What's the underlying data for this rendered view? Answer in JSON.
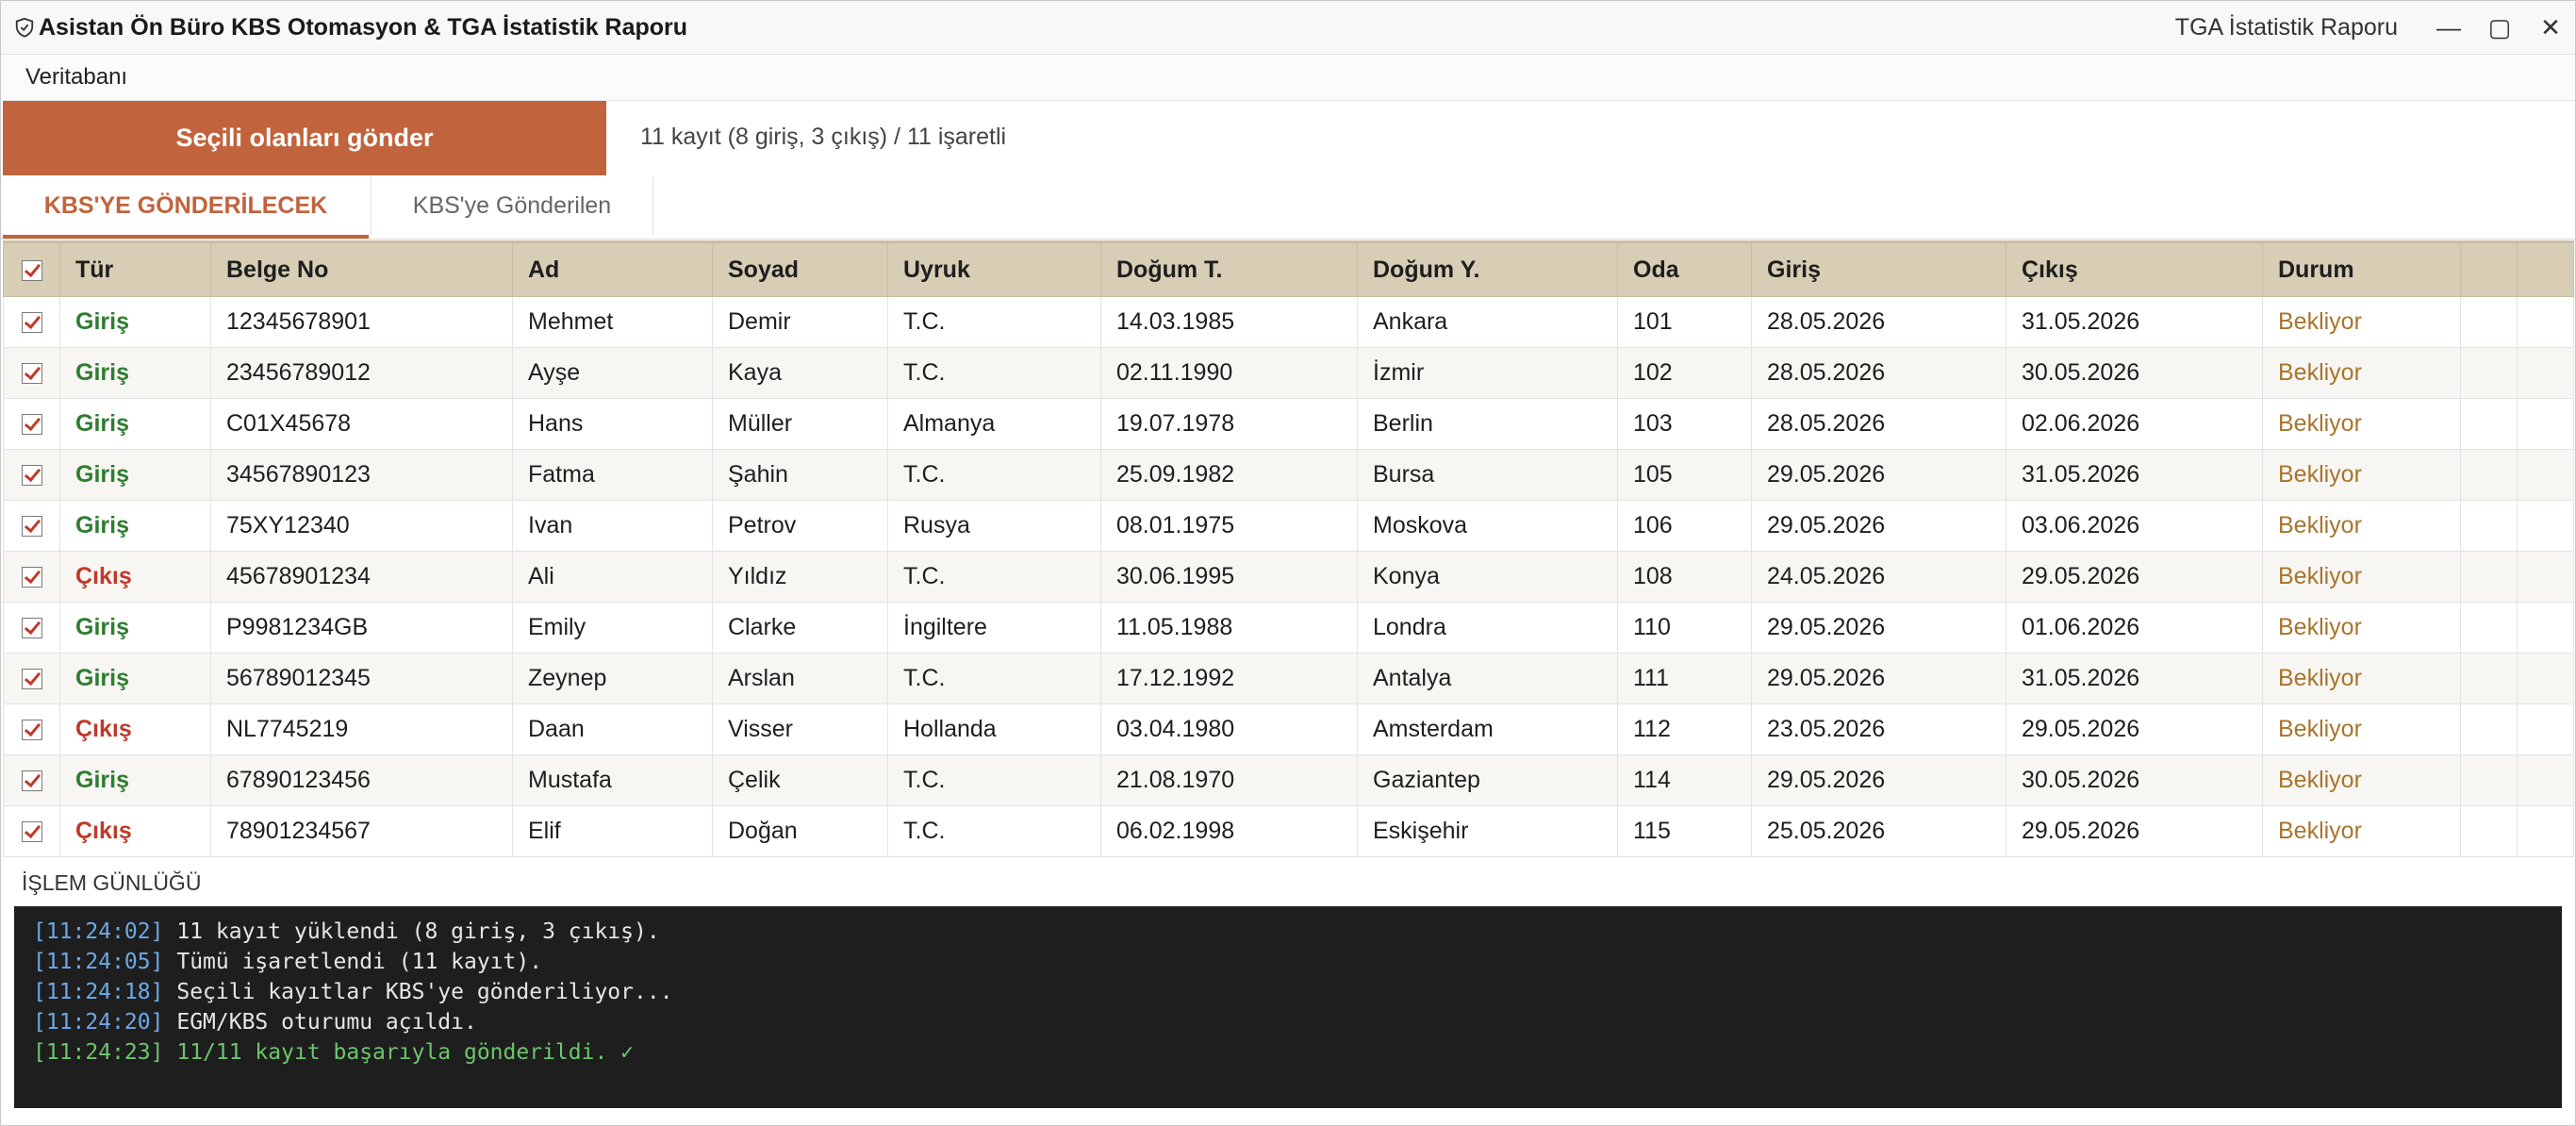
{
  "window": {
    "title": "Asistan Ön Büro KBS Otomasyon & TGA İstatistik Raporu",
    "right_title": "TGA İstatistik Raporu",
    "minimize": "—",
    "maximize": "▢",
    "close": "✕"
  },
  "menu": {
    "items": [
      "Veritabanı"
    ]
  },
  "toolbar": {
    "send_label": "Seçili olanları gönder",
    "summary": "11 kayıt (8 giriş, 3 çıkış) / 11 işaretli"
  },
  "tabs": [
    {
      "label": "KBS'YE GÖNDERİLECEK",
      "active": true
    },
    {
      "label": "KBS'ye Gönderilen",
      "active": false
    }
  ],
  "table": {
    "columns": [
      "",
      "Tür",
      "Belge No",
      "Ad",
      "Soyad",
      "Uyruk",
      "Doğum T.",
      "Doğum Y.",
      "Oda",
      "Giriş",
      "Çıkış",
      "Durum",
      "",
      ""
    ],
    "rows": [
      {
        "type": "Giriş",
        "doc": "12345678901",
        "name": "Mehmet",
        "surname": "Demir",
        "nationality": "T.C.",
        "birth_date": "14.03.1985",
        "birth_place": "Ankara",
        "room": "101",
        "checkin": "28.05.2026",
        "checkout": "31.05.2026",
        "status": "Bekliyor"
      },
      {
        "type": "Giriş",
        "doc": "23456789012",
        "name": "Ayşe",
        "surname": "Kaya",
        "nationality": "T.C.",
        "birth_date": "02.11.1990",
        "birth_place": "İzmir",
        "room": "102",
        "checkin": "28.05.2026",
        "checkout": "30.05.2026",
        "status": "Bekliyor"
      },
      {
        "type": "Giriş",
        "doc": "C01X45678",
        "name": "Hans",
        "surname": "Müller",
        "nationality": "Almanya",
        "birth_date": "19.07.1978",
        "birth_place": "Berlin",
        "room": "103",
        "checkin": "28.05.2026",
        "checkout": "02.06.2026",
        "status": "Bekliyor"
      },
      {
        "type": "Giriş",
        "doc": "34567890123",
        "name": "Fatma",
        "surname": "Şahin",
        "nationality": "T.C.",
        "birth_date": "25.09.1982",
        "birth_place": "Bursa",
        "room": "105",
        "checkin": "29.05.2026",
        "checkout": "31.05.2026",
        "status": "Bekliyor"
      },
      {
        "type": "Giriş",
        "doc": "75XY12340",
        "name": "Ivan",
        "surname": "Petrov",
        "nationality": "Rusya",
        "birth_date": "08.01.1975",
        "birth_place": "Moskova",
        "room": "106",
        "checkin": "29.05.2026",
        "checkout": "03.06.2026",
        "status": "Bekliyor"
      },
      {
        "type": "Çıkış",
        "doc": "45678901234",
        "name": "Ali",
        "surname": "Yıldız",
        "nationality": "T.C.",
        "birth_date": "30.06.1995",
        "birth_place": "Konya",
        "room": "108",
        "checkin": "24.05.2026",
        "checkout": "29.05.2026",
        "status": "Bekliyor"
      },
      {
        "type": "Giriş",
        "doc": "P9981234GB",
        "name": "Emily",
        "surname": "Clarke",
        "nationality": "İngiltere",
        "birth_date": "11.05.1988",
        "birth_place": "Londra",
        "room": "110",
        "checkin": "29.05.2026",
        "checkout": "01.06.2026",
        "status": "Bekliyor"
      },
      {
        "type": "Giriş",
        "doc": "56789012345",
        "name": "Zeynep",
        "surname": "Arslan",
        "nationality": "T.C.",
        "birth_date": "17.12.1992",
        "birth_place": "Antalya",
        "room": "111",
        "checkin": "29.05.2026",
        "checkout": "31.05.2026",
        "status": "Bekliyor"
      },
      {
        "type": "Çıkış",
        "doc": "NL7745219",
        "name": "Daan",
        "surname": "Visser",
        "nationality": "Hollanda",
        "birth_date": "03.04.1980",
        "birth_place": "Amsterdam",
        "room": "112",
        "checkin": "23.05.2026",
        "checkout": "29.05.2026",
        "status": "Bekliyor"
      },
      {
        "type": "Giriş",
        "doc": "67890123456",
        "name": "Mustafa",
        "surname": "Çelik",
        "nationality": "T.C.",
        "birth_date": "21.08.1970",
        "birth_place": "Gaziantep",
        "room": "114",
        "checkin": "29.05.2026",
        "checkout": "30.05.2026",
        "status": "Bekliyor"
      },
      {
        "type": "Çıkış",
        "doc": "78901234567",
        "name": "Elif",
        "surname": "Doğan",
        "nationality": "T.C.",
        "birth_date": "06.02.1998",
        "birth_place": "Eskişehir",
        "room": "115",
        "checkin": "25.05.2026",
        "checkout": "29.05.2026",
        "status": "Bekliyor"
      }
    ]
  },
  "log": {
    "label": "İŞLEM GÜNLÜĞÜ",
    "lines": [
      {
        "time": "[11:24:02]",
        "text": "11 kayıt yüklendi (8 giriş, 3 çıkış).",
        "success": false
      },
      {
        "time": "[11:24:05]",
        "text": "Tümü işaretlendi (11 kayıt).",
        "success": false
      },
      {
        "time": "[11:24:18]",
        "text": "Seçili kayıtlar KBS'ye gönderiliyor...",
        "success": false
      },
      {
        "time": "[11:24:20]",
        "text": "EGM/KBS oturumu açıldı.",
        "success": false
      },
      {
        "time": "[11:24:23]",
        "text": "11/11 kayıt başarıyla gönderildi. ✓",
        "success": true
      }
    ]
  },
  "colors": {
    "accent": "#c1633d",
    "header_bg": "#d7ceb5",
    "giris": "#2e7d32",
    "cikis": "#c0392b",
    "status": "#a7752c",
    "log_bg": "#1e1e1e"
  }
}
